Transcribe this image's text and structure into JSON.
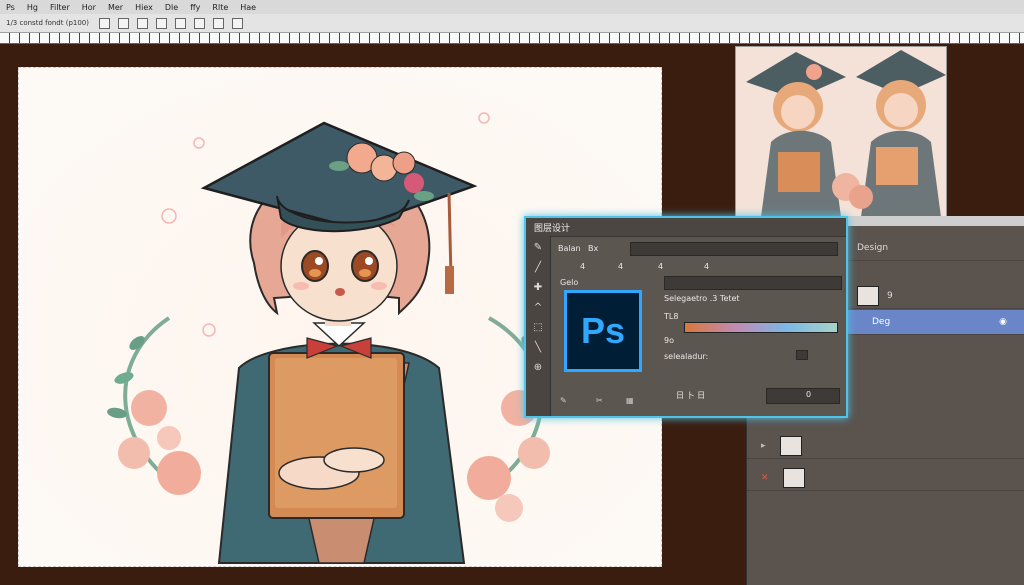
{
  "menubar": {
    "items": [
      "Ps",
      "Hg",
      "Filter",
      "Hor",
      "Mer",
      "Hiex",
      "Dle",
      "ffy",
      "Rlte",
      "Hae"
    ]
  },
  "options_bar": {
    "doc_info": "1/3 constd  fondt  (p100)"
  },
  "dialog": {
    "title": "图层设计",
    "field_label": "Balan",
    "field2": "Bx",
    "tick_labels": [
      "4",
      "4",
      "4",
      "4"
    ],
    "section_label": "Gelo",
    "ps_logo": "Ps",
    "setting_text": "Selegaetro  .3 Tetet",
    "tl_label": "TL8",
    "value_label": "9o",
    "bottom_text": "selealadur:",
    "footer_text": "日  卜  日",
    "footer_value": "0"
  },
  "right_panel": {
    "design_label": "Design",
    "layers": [
      {
        "name": "Design",
        "selected": false
      },
      {
        "name": "9",
        "selected": false
      },
      {
        "name": "Deg",
        "selected": true
      }
    ]
  },
  "colors": {
    "accent": "#4fc3e8",
    "ps_blue": "#31a8ff",
    "ps_dark": "#001e36"
  }
}
